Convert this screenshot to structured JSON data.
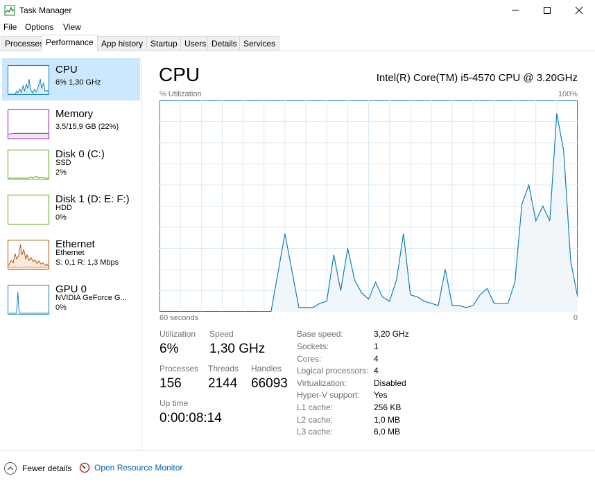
{
  "window": {
    "title": "Task Manager",
    "minimize_icon": "minimize-icon",
    "maximize_icon": "maximize-icon",
    "close_icon": "close-icon"
  },
  "menu": {
    "items": [
      "File",
      "Options",
      "View"
    ]
  },
  "tabs": {
    "items": [
      "Processes",
      "Performance",
      "App history",
      "Startup",
      "Users",
      "Details",
      "Services"
    ],
    "active": "Performance"
  },
  "sidebar": {
    "items": [
      {
        "title": "CPU",
        "line1": "6% 1,30 GHz",
        "line2": "",
        "color": "#117dbb"
      },
      {
        "title": "Memory",
        "line1": "3,5/15,9 GB (22%)",
        "line2": "",
        "color": "#8b12ae"
      },
      {
        "title": "Disk 0 (C:)",
        "line1": "SSD",
        "line2": "2%",
        "color": "#4da60c"
      },
      {
        "title": "Disk 1 (D: E: F:)",
        "line1": "HDD",
        "line2": "0%",
        "color": "#4da60c"
      },
      {
        "title": "Ethernet",
        "line1": "Ethernet",
        "line2": "S: 0,1  R: 1,3 Mbps",
        "color": "#a74f01"
      },
      {
        "title": "GPU 0",
        "line1": "NVIDIA GeForce G...",
        "line2": "0%",
        "color": "#117dbb"
      }
    ]
  },
  "main": {
    "title": "CPU",
    "model": "Intel(R) Core(TM) i5-4570 CPU @ 3.20GHz",
    "y_label": "% Utilization",
    "y_max": "100%",
    "x_left": "60 seconds",
    "x_right": "0",
    "stats": {
      "utilization_label": "Utilization",
      "utilization": "6%",
      "speed_label": "Speed",
      "speed": "1,30 GHz",
      "processes_label": "Processes",
      "processes": "156",
      "threads_label": "Threads",
      "threads": "2144",
      "handles_label": "Handles",
      "handles": "66093",
      "uptime_label": "Up time",
      "uptime": "0:00:08:14"
    },
    "props": [
      {
        "label": "Base speed:",
        "value": "3,20 GHz"
      },
      {
        "label": "Sockets:",
        "value": "1"
      },
      {
        "label": "Cores:",
        "value": "4"
      },
      {
        "label": "Logical processors:",
        "value": "4"
      },
      {
        "label": "Virtualization:",
        "value": "Disabled"
      },
      {
        "label": "Hyper-V support:",
        "value": "Yes"
      },
      {
        "label": "L1 cache:",
        "value": "256 KB"
      },
      {
        "label": "L2 cache:",
        "value": "1,0 MB"
      },
      {
        "label": "L3 cache:",
        "value": "6,0 MB"
      }
    ]
  },
  "chart_data": {
    "type": "area",
    "x": [
      60,
      58,
      56,
      54,
      52,
      50,
      48,
      46,
      44,
      42,
      40,
      38,
      37,
      36,
      35,
      34,
      33,
      32,
      31,
      30,
      29,
      28,
      27,
      26,
      25,
      24,
      23,
      22,
      21,
      20,
      19,
      18,
      17,
      16,
      15,
      14,
      13,
      12,
      11,
      10,
      9,
      8,
      7,
      6,
      5,
      4,
      3,
      2,
      1,
      0
    ],
    "values": [
      0,
      0,
      0,
      0,
      0,
      0,
      0,
      0,
      0,
      37,
      2,
      2,
      4,
      5,
      27,
      10,
      30,
      15,
      9,
      6,
      14,
      7,
      5,
      15,
      37,
      8,
      7,
      5,
      4,
      3,
      20,
      3,
      3,
      2,
      3,
      8,
      11,
      4,
      4,
      4,
      14,
      51,
      60,
      43,
      50,
      43,
      94,
      76,
      24,
      7
    ],
    "ylim": [
      0,
      100
    ],
    "xlim": [
      60,
      0
    ],
    "grid": true,
    "line_color": "#117dbb",
    "fill_color": "#f1f6fa"
  },
  "footer": {
    "fewer_details": "Fewer details",
    "open_monitor": "Open Resource Monitor"
  }
}
